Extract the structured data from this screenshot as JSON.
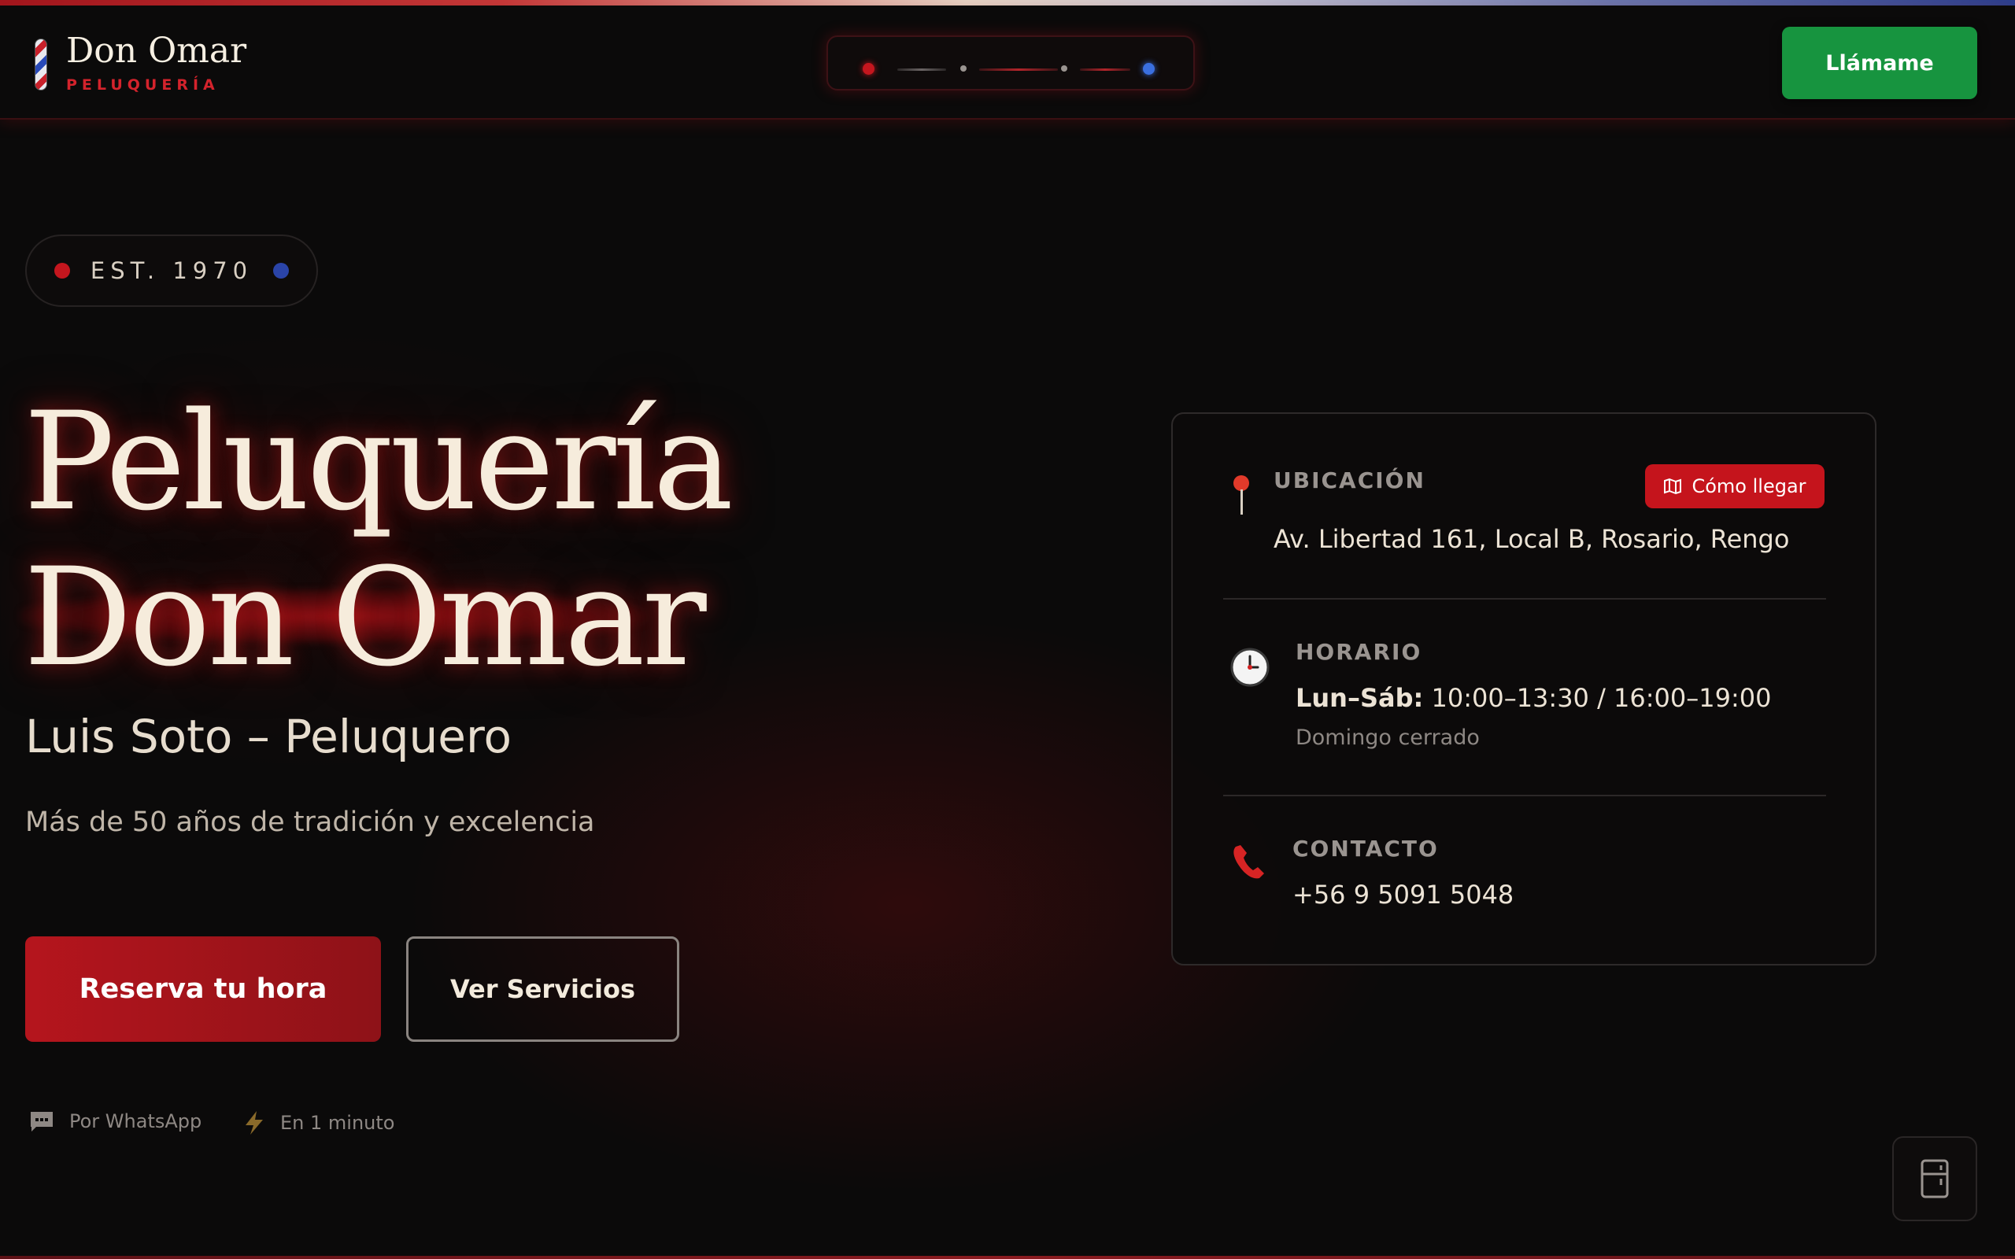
{
  "header": {
    "logo_title": "Don Omar",
    "logo_subtitle": "PELUQUERÍA",
    "call_label": "Llámame"
  },
  "hero": {
    "est_label": "EST. 1970",
    "title_line1": "Peluquería",
    "title_line2": "Don Omar",
    "subtitle": "Luis Soto – Peluquero",
    "tagline": "Más de 50 años de tradición y excelencia",
    "primary_cta": "Reserva tu hora",
    "secondary_cta": "Ver Servicios",
    "meta_whatsapp": "Por WhatsApp",
    "meta_time": "En 1 minuto"
  },
  "info_card": {
    "location": {
      "label": "UBICACIÓN",
      "address": "Av. Libertad 161, Local B, Rosario, Rengo",
      "directions_label": "Cómo llegar"
    },
    "hours": {
      "label": "HORARIO",
      "days": "Lun–Sáb:",
      "times": "10:00–13:30 / 16:00–19:00",
      "closed_note": "Domingo cerrado"
    },
    "contact": {
      "label": "CONTACTO",
      "phone": "+56 9 5091 5048"
    }
  },
  "colors": {
    "accent_red": "#c5141c",
    "accent_blue": "#2849b8",
    "call_green": "#17943f",
    "background": "#0b0a0a",
    "cream_text": "#f6ecdc"
  },
  "icons": [
    "barber-pole-icon",
    "pin-icon",
    "clock-icon",
    "phone-icon",
    "map-icon",
    "chat-icon",
    "lightning-icon",
    "fridge-icon"
  ]
}
